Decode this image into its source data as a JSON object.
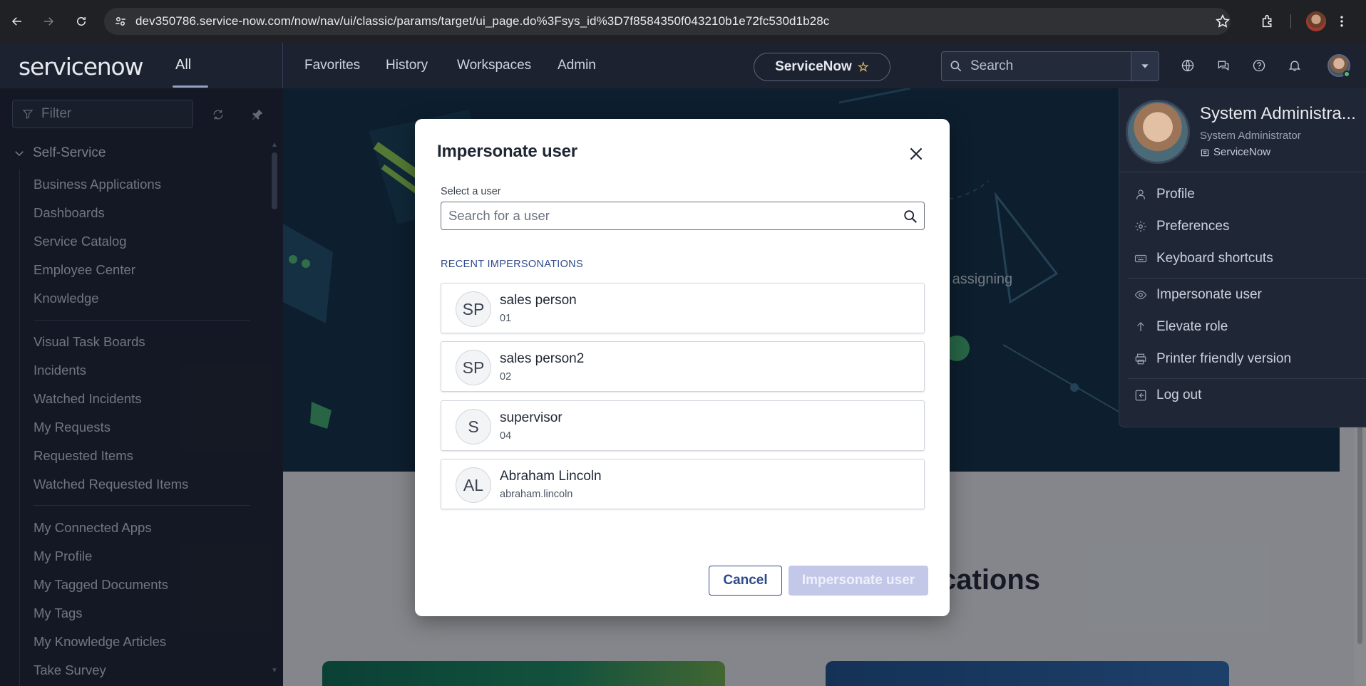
{
  "browser": {
    "url": "dev350786.service-now.com/now/nav/ui/classic/params/target/ui_page.do%3Fsys_id%3D7f8584350f043210b1e72fc530d1b28c"
  },
  "header": {
    "logo": "servicenow",
    "all_tab": "All",
    "nav": [
      "Favorites",
      "History",
      "Workspaces",
      "Admin"
    ],
    "instance_name": "ServiceNow",
    "search_placeholder": "Search"
  },
  "sidebar": {
    "filter_placeholder": "Filter",
    "section_title": "Self-Service",
    "groups": [
      [
        "Business Applications",
        "Dashboards",
        "Service Catalog",
        "Employee Center",
        "Knowledge"
      ],
      [
        "Visual Task Boards",
        "Incidents",
        "Watched Incidents",
        "My Requests",
        "Requested Items",
        "Watched Requested Items"
      ],
      [
        "My Connected Apps",
        "My Profile",
        "My Tagged Documents",
        "My Tags",
        "My Knowledge Articles",
        "Take Survey"
      ]
    ]
  },
  "main": {
    "hero_text": "d assigning",
    "apps_heading": "cations"
  },
  "user_menu": {
    "name": "System Administra...",
    "role": "System Administrator",
    "instance": "ServiceNow",
    "items": [
      {
        "label": "Profile",
        "icon": "user-icon"
      },
      {
        "label": "Preferences",
        "icon": "gear-icon"
      },
      {
        "label": "Keyboard shortcuts",
        "icon": "keyboard-icon"
      },
      {
        "label": "Impersonate user",
        "icon": "eye-icon"
      },
      {
        "label": "Elevate role",
        "icon": "arrow-up-icon"
      },
      {
        "label": "Printer friendly version",
        "icon": "printer-icon"
      },
      {
        "label": "Log out",
        "icon": "logout-icon"
      }
    ]
  },
  "modal": {
    "title": "Impersonate user",
    "select_label": "Select a user",
    "search_placeholder": "Search for a user",
    "recent_label": "RECENT IMPERSONATIONS",
    "recent_users": [
      {
        "initials": "SP",
        "name": "sales person",
        "sub": "01"
      },
      {
        "initials": "SP",
        "name": "sales person2",
        "sub": "02"
      },
      {
        "initials": "S",
        "name": "supervisor",
        "sub": "04"
      },
      {
        "initials": "AL",
        "name": "Abraham Lincoln",
        "sub": "abraham.lincoln"
      }
    ],
    "cancel_label": "Cancel",
    "impersonate_label": "Impersonate user"
  },
  "colors": {
    "primary": "#2f4a8c",
    "disabled_button": "#c3c8e8",
    "header_bg": "#1c2230",
    "accent_green": "#8fd14f"
  }
}
